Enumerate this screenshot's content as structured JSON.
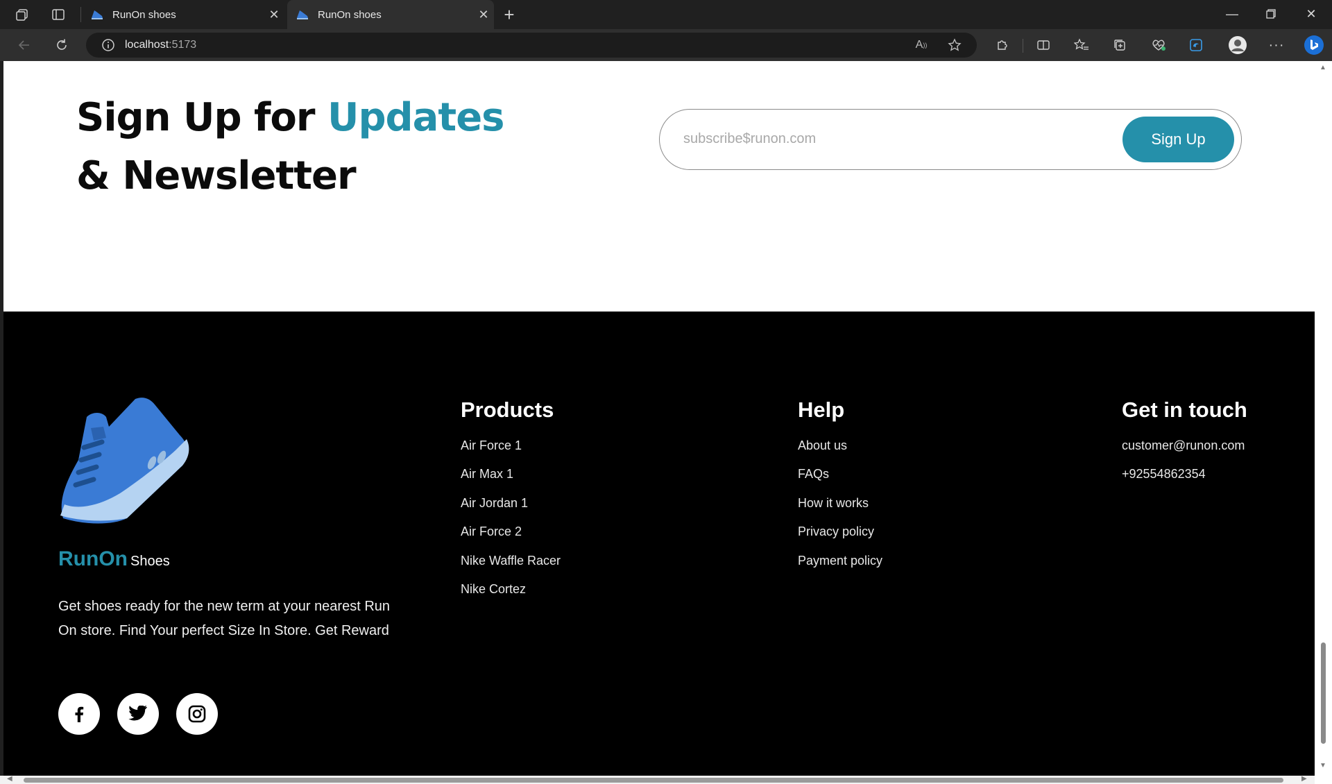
{
  "browser": {
    "tabs": [
      {
        "title": "RunOn shoes",
        "active": false
      },
      {
        "title": "RunOn shoes",
        "active": true
      }
    ],
    "address": {
      "host": "localhost",
      "port": ":5173"
    }
  },
  "newsletter": {
    "title_part1": "Sign Up for ",
    "title_accent": "Updates",
    "title_line2": "& Newsletter",
    "input_placeholder": "subscribe$runon.com",
    "button_label": "Sign Up"
  },
  "footer": {
    "brand_name": "RunOn",
    "brand_suffix": "Shoes",
    "description": "Get shoes ready for the new term at your nearest Run On store. Find Your perfect Size In Store. Get Reward",
    "social": [
      "facebook-icon",
      "twitter-icon",
      "instagram-icon"
    ],
    "products": {
      "title": "Products",
      "items": [
        "Air Force 1",
        "Air Max 1",
        "Air Jordan 1",
        "Air Force 2",
        "Nike Waffle Racer",
        "Nike Cortez"
      ]
    },
    "help": {
      "title": "Help",
      "items": [
        "About us",
        "FAQs",
        "How it works",
        "Privacy policy",
        "Payment policy"
      ]
    },
    "contact": {
      "title": "Get in touch",
      "items": [
        "customer@runon.com",
        "+92554862354"
      ]
    }
  },
  "colors": {
    "accent": "#2590aa",
    "footer_bg": "#000000",
    "chrome_bg": "#202020"
  }
}
